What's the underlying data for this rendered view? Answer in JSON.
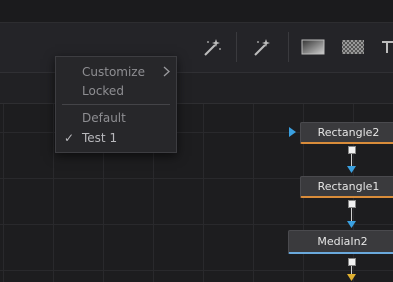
{
  "context_menu": {
    "items": [
      {
        "label": "Customize",
        "has_submenu": true,
        "checked": false
      },
      {
        "label": "Locked",
        "has_submenu": false,
        "checked": false
      },
      {
        "label": "Default",
        "has_submenu": false,
        "checked": false
      },
      {
        "label": "Test 1",
        "has_submenu": false,
        "checked": true
      }
    ],
    "check_glyph": "✓"
  },
  "toolbar": {
    "tools": [
      "magic-wand-icon",
      "magic-wand-icon",
      "gradient-rect-icon",
      "checker-pattern-icon",
      "text-tool-icon"
    ]
  },
  "nodes": [
    {
      "name": "Rectangle2",
      "accent": "#d98c3a"
    },
    {
      "name": "Rectangle1",
      "accent": "#d98c3a"
    },
    {
      "name": "MediaIn2",
      "accent": "#6aa9dc"
    }
  ],
  "colors": {
    "input_triangle": "#3aa0e0",
    "output_triangle": "#e0b030"
  }
}
